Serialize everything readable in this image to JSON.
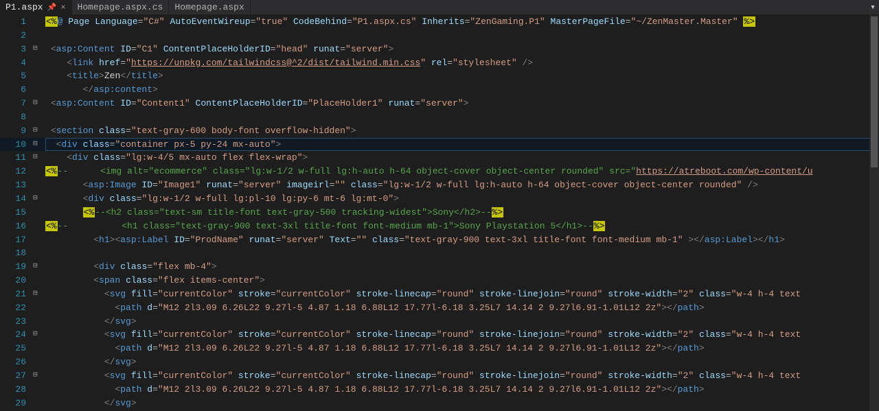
{
  "tabs": [
    {
      "label": "P1.aspx",
      "active": true,
      "pinned": true
    },
    {
      "label": "Homepage.aspx.cs",
      "active": false,
      "pinned": false
    },
    {
      "label": "Homepage.aspx",
      "active": false,
      "pinned": false
    }
  ],
  "dropdown_glyph": "▾",
  "close_glyph": "×",
  "pin_glyph": "📌",
  "minus_glyph": "⊟",
  "lines": [
    {
      "n": 1,
      "fold": "",
      "html": "<span class='bg-yel'>&lt;%</span><span class='elem'>@ </span><span class='attrname'>Page</span> <span class='attrname'>Language</span><span class='eq'>=</span><span class='attrval'>\"C#\"</span> <span class='attrname'>AutoEventWireup</span><span class='eq'>=</span><span class='attrval'>\"true\"</span> <span class='attrname'>CodeBehind</span><span class='eq'>=</span><span class='attrval'>\"P1.aspx.cs\"</span> <span class='attrname'>Inherits</span><span class='eq'>=</span><span class='attrval'>\"ZenGaming.P1\"</span> <span class='attrname'>MasterPageFile</span><span class='eq'>=</span><span class='attrval'>\"~/ZenMaster.Master\"</span> <span class='bg-yel'>%&gt;</span>"
    },
    {
      "n": 2,
      "fold": "",
      "html": ""
    },
    {
      "n": 3,
      "fold": "⊟",
      "html": " <span class='gray'>&lt;</span><span class='elem'>asp:Content</span> <span class='attrname'>ID</span><span class='eq'>=</span><span class='attrval'>\"C1\"</span> <span class='attrname'>ContentPlaceHolderID</span><span class='eq'>=</span><span class='attrval'>\"head\"</span> <span class='attrname'>runat</span><span class='eq'>=</span><span class='attrval'>\"server\"</span><span class='gray'>&gt;</span>"
    },
    {
      "n": 4,
      "fold": "",
      "html": "    <span class='gray'>&lt;</span><span class='elem'>link</span> <span class='attrname'>href</span><span class='eq'>=</span><span class='attrval'>\"<span class='urllink'>https://unpkg.com/tailwindcss@^2/dist/tailwind.min.css</span>\"</span> <span class='attrname'>rel</span><span class='eq'>=</span><span class='attrval'>\"stylesheet\"</span> <span class='gray'>/&gt;</span>"
    },
    {
      "n": 5,
      "fold": "",
      "html": "    <span class='gray'>&lt;</span><span class='elem'>title</span><span class='gray'>&gt;</span>Zen<span class='gray'>&lt;/</span><span class='elem'>title</span><span class='gray'>&gt;</span>"
    },
    {
      "n": 6,
      "fold": "",
      "html": "       <span class='gray'>&lt;/</span><span class='elem'>asp:content</span><span class='gray'>&gt;</span>"
    },
    {
      "n": 7,
      "fold": "⊟",
      "html": " <span class='gray'>&lt;</span><span class='elem'>asp:Content</span> <span class='attrname'>ID</span><span class='eq'>=</span><span class='attrval'>\"Content1\"</span> <span class='attrname'>ContentPlaceHolderID</span><span class='eq'>=</span><span class='attrval'>\"PlaceHolder1\"</span> <span class='attrname'>runat</span><span class='eq'>=</span><span class='attrval'>\"server\"</span><span class='gray'>&gt;</span>"
    },
    {
      "n": 8,
      "fold": "",
      "html": ""
    },
    {
      "n": 9,
      "fold": "⊟",
      "html": " <span class='gray'>&lt;</span><span class='elem'>section</span> <span class='attrname'>class</span><span class='eq'>=</span><span class='attrval'>\"text-gray-600 body-font overflow-hidden\"</span><span class='gray'>&gt;</span>"
    },
    {
      "n": 10,
      "fold": "⊟",
      "current": true,
      "html": "  <span class='gray'>&lt;</span><span class='elem'>div</span> <span class='attrname'>class</span><span class='eq'>=</span><span class='attrval'>\"container px-5 py-24 mx-auto\"</span><span class='gray'>&gt;</span>"
    },
    {
      "n": 11,
      "fold": "⊟",
      "html": "    <span class='gray'>&lt;</span><span class='elem'>div</span> <span class='attrname'>class</span><span class='eq'>=</span><span class='attrval'>\"lg:w-4/5 mx-auto flex flex-wrap\"</span><span class='gray'>&gt;</span>"
    },
    {
      "n": 12,
      "fold": "",
      "html": "<span class='bg-yel'>&lt;%</span><span class='comment'>--      &lt;<span class='green-el'>img</span> alt=\"ecommerce\" class=\"lg:w-1/2 w-full lg:h-auto h-64 object-cover object-center rounded\" src=\"<span class='urllink'>https://atreboot.com/wp-content/u</span></span>"
    },
    {
      "n": 13,
      "fold": "",
      "html": "       <span class='gray'>&lt;</span><span class='elem'>asp:Image</span> <span class='attrname'>ID</span><span class='eq'>=</span><span class='attrval'>\"Image1\"</span> <span class='attrname'>runat</span><span class='eq'>=</span><span class='attrval'>\"server\"</span> <span class='attrname'>imageirl</span><span class='eq'>=</span><span class='attrval'>\"\"</span> <span class='attrname'>class</span><span class='eq'>=</span><span class='attrval'>\"lg:w-1/2 w-full lg:h-auto h-64 object-cover object-center rounded\"</span> <span class='gray'>/&gt;</span>"
    },
    {
      "n": 14,
      "fold": "⊟",
      "html": "       <span class='gray'>&lt;</span><span class='elem'>div</span> <span class='attrname'>class</span><span class='eq'>=</span><span class='attrval'>\"lg:w-1/2 w-full lg:pl-10 lg:py-6 mt-6 lg:mt-0\"</span><span class='gray'>&gt;</span>"
    },
    {
      "n": 15,
      "fold": "",
      "html": "       <span class='bg-yel'>&lt;%</span><span class='comment'>--&lt;<span class='green-el'>h2</span> class=\"text-sm title-font text-gray-500 tracking-widest\"&gt;Sony&lt;/<span class='green-el'>h2</span>&gt;--</span><span class='bg-yel'>%&gt;</span>"
    },
    {
      "n": 16,
      "fold": "",
      "html": "<span class='bg-yel'>&lt;%</span><span class='comment'>--          &lt;<span class='green-el'>h1</span> class=\"text-gray-900 text-3xl title-font font-medium mb-1\"&gt;Sony Playstation 5&lt;/<span class='green-el'>h1</span>&gt;--</span><span class='bg-yel'>%&gt;</span>"
    },
    {
      "n": 17,
      "fold": "",
      "html": "         <span class='gray'>&lt;</span><span class='elem'>h1</span><span class='gray'>&gt;&lt;</span><span class='elem'>asp:Label</span> <span class='attrname'>ID</span><span class='eq'>=</span><span class='attrval'>\"ProdName\"</span> <span class='attrname'>runat</span><span class='eq'>=</span><span class='attrval'>\"server\"</span> <span class='attrname'>Text</span><span class='eq'>=</span><span class='attrval'>\"\"</span> <span class='attrname'>class</span><span class='eq'>=</span><span class='attrval'>\"text-gray-900 text-3xl title-font font-medium mb-1\"</span> <span class='gray'>&gt;&lt;/</span><span class='elem'>asp:Label</span><span class='gray'>&gt;&lt;/</span><span class='elem'>h1</span><span class='gray'>&gt;</span>"
    },
    {
      "n": 18,
      "fold": "",
      "html": ""
    },
    {
      "n": 19,
      "fold": "⊟",
      "html": "         <span class='gray'>&lt;</span><span class='elem'>div</span> <span class='attrname'>class</span><span class='eq'>=</span><span class='attrval'>\"flex mb-4\"</span><span class='gray'>&gt;</span>"
    },
    {
      "n": 20,
      "fold": "",
      "html": "         <span class='gray'>&lt;</span><span class='elem'>span</span> <span class='attrname'>class</span><span class='eq'>=</span><span class='attrval'>\"flex items-center\"</span><span class='gray'>&gt;</span>"
    },
    {
      "n": 21,
      "fold": "⊟",
      "html": "           <span class='gray'>&lt;</span><span class='elem'>svg</span> <span class='attrname'>fill</span><span class='eq'>=</span><span class='attrval'>\"currentColor\"</span> <span class='attrname'>stroke</span><span class='eq'>=</span><span class='attrval'>\"currentColor\"</span> <span class='attrname'>stroke-linecap</span><span class='eq'>=</span><span class='attrval'>\"round\"</span> <span class='attrname'>stroke-linejoin</span><span class='eq'>=</span><span class='attrval'>\"round\"</span> <span class='attrname'>stroke-width</span><span class='eq'>=</span><span class='attrval'>\"2\"</span> <span class='attrname'>class</span><span class='eq'>=</span><span class='attrval'>\"w-4 h-4 text</span>"
    },
    {
      "n": 22,
      "fold": "",
      "html": "             <span class='gray'>&lt;</span><span class='elem'>path</span> <span class='attrname'>d</span><span class='eq'>=</span><span class='attrval'>\"M12 2l3.09 6.26L22 9.27l-5 4.87 1.18 6.88L12 17.77l-6.18 3.25L7 14.14 2 9.27l6.91-1.01L12 2z\"</span><span class='gray'>&gt;&lt;/</span><span class='elem'>path</span><span class='gray'>&gt;</span>"
    },
    {
      "n": 23,
      "fold": "",
      "html": "           <span class='gray'>&lt;/</span><span class='elem'>svg</span><span class='gray'>&gt;</span>"
    },
    {
      "n": 24,
      "fold": "⊟",
      "html": "           <span class='gray'>&lt;</span><span class='elem'>svg</span> <span class='attrname'>fill</span><span class='eq'>=</span><span class='attrval'>\"currentColor\"</span> <span class='attrname'>stroke</span><span class='eq'>=</span><span class='attrval'>\"currentColor\"</span> <span class='attrname'>stroke-linecap</span><span class='eq'>=</span><span class='attrval'>\"round\"</span> <span class='attrname'>stroke-linejoin</span><span class='eq'>=</span><span class='attrval'>\"round\"</span> <span class='attrname'>stroke-width</span><span class='eq'>=</span><span class='attrval'>\"2\"</span> <span class='attrname'>class</span><span class='eq'>=</span><span class='attrval'>\"w-4 h-4 text</span>"
    },
    {
      "n": 25,
      "fold": "",
      "html": "             <span class='gray'>&lt;</span><span class='elem'>path</span> <span class='attrname'>d</span><span class='eq'>=</span><span class='attrval'>\"M12 2l3.09 6.26L22 9.27l-5 4.87 1.18 6.88L12 17.77l-6.18 3.25L7 14.14 2 9.27l6.91-1.01L12 2z\"</span><span class='gray'>&gt;&lt;/</span><span class='elem'>path</span><span class='gray'>&gt;</span>"
    },
    {
      "n": 26,
      "fold": "",
      "html": "           <span class='gray'>&lt;/</span><span class='elem'>svg</span><span class='gray'>&gt;</span>"
    },
    {
      "n": 27,
      "fold": "⊟",
      "html": "           <span class='gray'>&lt;</span><span class='elem'>svg</span> <span class='attrname'>fill</span><span class='eq'>=</span><span class='attrval'>\"currentColor\"</span> <span class='attrname'>stroke</span><span class='eq'>=</span><span class='attrval'>\"currentColor\"</span> <span class='attrname'>stroke-linecap</span><span class='eq'>=</span><span class='attrval'>\"round\"</span> <span class='attrname'>stroke-linejoin</span><span class='eq'>=</span><span class='attrval'>\"round\"</span> <span class='attrname'>stroke-width</span><span class='eq'>=</span><span class='attrval'>\"2\"</span> <span class='attrname'>class</span><span class='eq'>=</span><span class='attrval'>\"w-4 h-4 text</span>"
    },
    {
      "n": 28,
      "fold": "",
      "html": "             <span class='gray'>&lt;</span><span class='elem'>path</span> <span class='attrname'>d</span><span class='eq'>=</span><span class='attrval'>\"M12 2l3.09 6.26L22 9.27l-5 4.87 1.18 6.88L12 17.77l-6.18 3.25L7 14.14 2 9.27l6.91-1.01L12 2z\"</span><span class='gray'>&gt;&lt;/</span><span class='elem'>path</span><span class='gray'>&gt;</span>"
    },
    {
      "n": 29,
      "fold": "",
      "html": "           <span class='gray'>&lt;/</span><span class='elem'>svg</span><span class='gray'>&gt;</span>"
    }
  ]
}
